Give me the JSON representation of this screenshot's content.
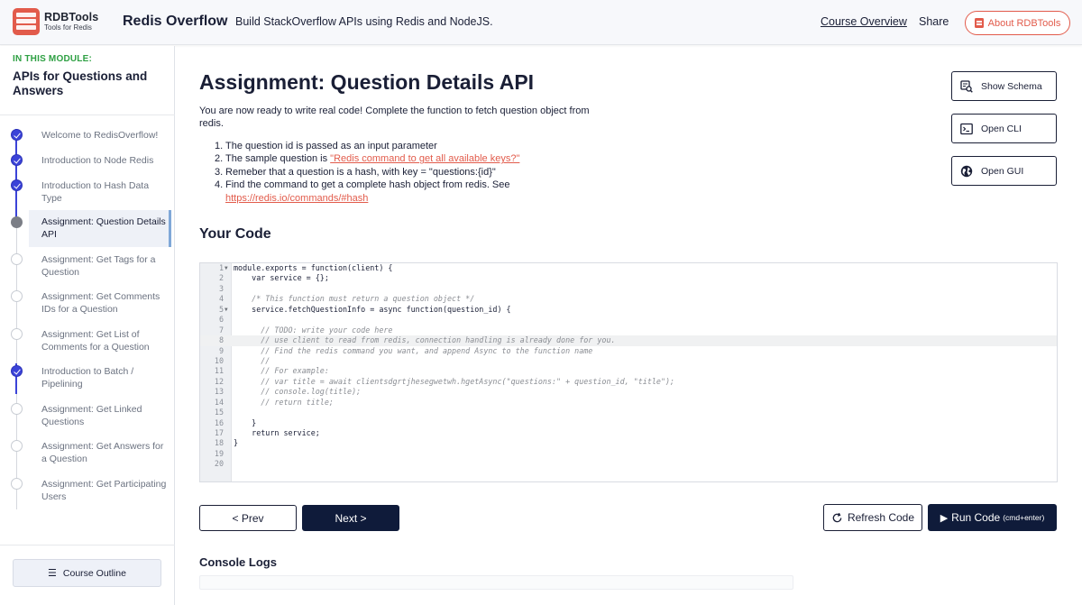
{
  "header": {
    "logo": {
      "title": "RDBTools",
      "subtitle": "Tools for Redis"
    },
    "app_title": "Redis Overflow",
    "tagline": "Build StackOverflow APIs using Redis and NodeJS.",
    "nav": {
      "course_overview": "Course Overview",
      "share": "Share"
    },
    "about_button": "About RDBTools",
    "accent_color": "#e25b4b"
  },
  "sidebar": {
    "module_label": "IN THIS MODULE:",
    "module_title": "APIs for Questions and Answers",
    "steps": [
      {
        "label": "Welcome to RedisOverflow!",
        "status": "done"
      },
      {
        "label": "Introduction to Node Redis",
        "status": "done"
      },
      {
        "label": "Introduction to Hash Data Type",
        "status": "done"
      },
      {
        "label": "Assignment: Question Details API",
        "status": "current"
      },
      {
        "label": "Assignment: Get Tags for a Question",
        "status": "todo"
      },
      {
        "label": "Assignment: Get Comments IDs for a Question",
        "status": "todo"
      },
      {
        "label": "Assignment: Get List of Comments for a Question",
        "status": "todo"
      },
      {
        "label": "Introduction to Batch / Pipelining",
        "status": "done"
      },
      {
        "label": "Assignment: Get Linked Questions",
        "status": "todo"
      },
      {
        "label": "Assignment: Get Answers for a Question",
        "status": "todo"
      },
      {
        "label": "Assignment: Get Participating Users",
        "status": "todo"
      }
    ],
    "outline_button": "Course Outline",
    "done_color": "#3b43d8"
  },
  "main": {
    "title": "Assignment: Question Details API",
    "intro": "You are now ready to write real code! Complete the function to fetch question object from redis.",
    "instructions": {
      "i1": "The question id is passed as an input parameter",
      "i2_prefix": "The sample question is ",
      "i2_link": "\"Redis command to get all available keys?\"",
      "i3": "Remeber that a question is a hash, with key = \"questions:{id}\"",
      "i4_prefix": "Find the command to get a complete hash object from redis. See ",
      "i4_link": "https://redis.io/commands/#hash"
    },
    "your_code_title": "Your Code",
    "console_title": "Console Logs"
  },
  "tools": {
    "show_schema": "Show Schema",
    "open_cli": "Open CLI",
    "open_gui": "Open GUI"
  },
  "editor": {
    "highlighted_line": 8,
    "lines": [
      "module.exports = function(client) {",
      "    var service = {};",
      "",
      "    /* This function must return a question object */",
      "    service.fetchQuestionInfo = async function(question_id) {",
      "",
      "      // TODO: write your code here",
      "      // use client to read from redis, connection handling is already done for you.",
      "      // Find the redis command you want, and append Async to the function name",
      "      //",
      "      // For example:",
      "      // var title = await clientsdgrtjhesegwetwh.hgetAsync(\"questions:\" + question_id, \"title\");",
      "      // console.log(title);",
      "      // return title;",
      "",
      "    }",
      "    return service;",
      "}",
      "",
      ""
    ]
  },
  "buttons": {
    "prev": "< Prev",
    "next": "Next >",
    "refresh": "Refresh Code",
    "run": "Run Code",
    "run_shortcut": "(cmd+enter)"
  }
}
